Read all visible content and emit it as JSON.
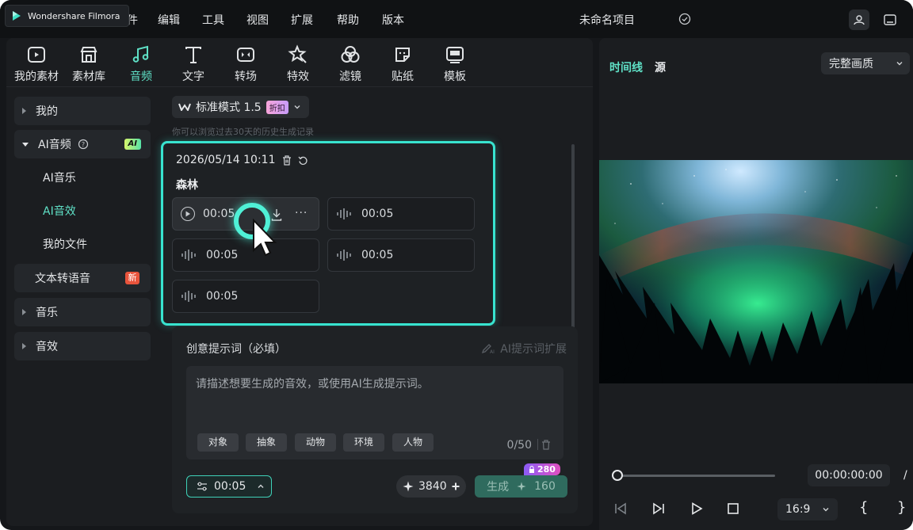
{
  "app": {
    "name": "Wondershare Filmora",
    "hidden_menu_fragment": "文件",
    "menu": [
      "编辑",
      "工具",
      "视图",
      "扩展",
      "帮助",
      "版本"
    ],
    "project_title": "未命名项目"
  },
  "toolbar": [
    {
      "label": "我的素材",
      "icon": "media-icon"
    },
    {
      "label": "素材库",
      "icon": "store-icon"
    },
    {
      "label": "音频",
      "icon": "music-note-icon",
      "active": true
    },
    {
      "label": "文字",
      "icon": "text-icon"
    },
    {
      "label": "转场",
      "icon": "transition-icon"
    },
    {
      "label": "特效",
      "icon": "effects-icon"
    },
    {
      "label": "滤镜",
      "icon": "filter-icon"
    },
    {
      "label": "贴纸",
      "icon": "sticker-icon"
    },
    {
      "label": "模板",
      "icon": "template-icon"
    }
  ],
  "sidebar": {
    "mine": "我的",
    "ai_audio": "AI音频",
    "ai_badge": "AI",
    "ai_music": "AI音乐",
    "ai_sfx": "AI音效",
    "my_files": "我的文件",
    "tts": "文本转语音",
    "new_badge": "新",
    "music": "音乐",
    "sfx": "音效"
  },
  "content": {
    "mode_label": "标准模式 1.5",
    "discount_badge": "折扣",
    "history_hint": "你可以浏览过去30天的历史生成记录",
    "card": {
      "date": "2026/05/14 10:11",
      "name": "森林",
      "clips": [
        "00:05",
        "00:05",
        "00:05",
        "00:05",
        "00:05"
      ],
      "more": "···"
    },
    "prompt": {
      "title": "创意提示词（必填）",
      "ai_expand": "AI提示词扩展",
      "placeholder": "请描述想要生成的音效，或使用AI生成提示词。",
      "tags": [
        "对象",
        "抽象",
        "动物",
        "环境",
        "人物"
      ],
      "counter": "0/50"
    },
    "duration": "00:05",
    "credits": "3840",
    "generate_label": "生成",
    "generate_cost": "160",
    "cost_badge": "280"
  },
  "preview": {
    "tab_timeline": "时间线",
    "tab_source": "源",
    "quality": "完整画质",
    "timecode": "00:00:00:00",
    "slash": "/",
    "ratio": "16:9",
    "brace_left": "{",
    "brace_right": "}",
    "progress": 0
  },
  "colors": {
    "accent": "#5fe0c6",
    "card_border": "#38e3cf",
    "generate_bg": "#2f6b5e",
    "new_badge": "#e8543c"
  }
}
